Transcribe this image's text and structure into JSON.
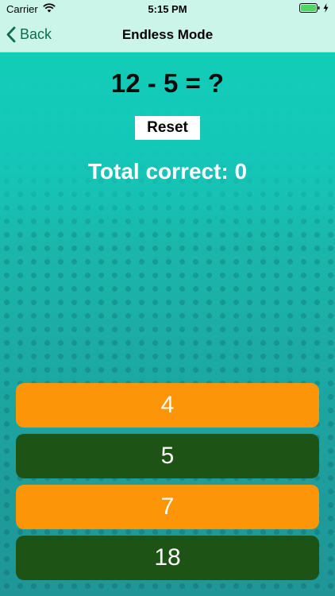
{
  "status_bar": {
    "carrier": "Carrier",
    "time": "5:15 PM"
  },
  "nav": {
    "back_label": "Back",
    "title": "Endless Mode"
  },
  "game": {
    "question": "12 - 5 = ?",
    "reset_label": "Reset",
    "total_correct": "Total correct: 0",
    "answers": [
      {
        "label": "4",
        "color": "#fd9508"
      },
      {
        "label": "5",
        "color": "#1d5415"
      },
      {
        "label": "7",
        "color": "#fd9508"
      },
      {
        "label": "18",
        "color": "#1d5415"
      }
    ]
  },
  "colors": {
    "nav_background": "#ccf5ea",
    "back_tint": "#0c6e4f",
    "teal_top": "#18c7b7",
    "teal_bottom": "#1f9597",
    "answer_orange": "#fd9508",
    "answer_green": "#1d5415"
  },
  "icons": {
    "wifi": "wifi-icon",
    "battery": "battery-icon",
    "charging": "charging-bolt-icon",
    "back": "chevron-left-icon"
  }
}
